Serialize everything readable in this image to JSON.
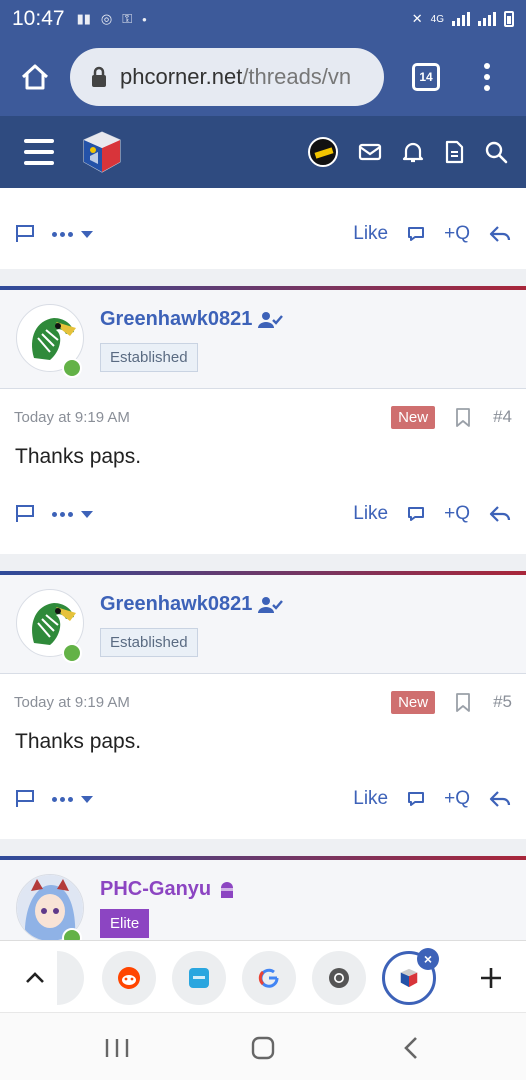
{
  "status_bar": {
    "time": "10:47",
    "network": "4G"
  },
  "browser": {
    "url_host": "phcorner.net",
    "url_path": "/threads/vn",
    "tab_count": "14"
  },
  "top_post": {
    "like_label": "Like",
    "quote_label": "Q"
  },
  "posts": [
    {
      "username": "Greenhawk0821",
      "user_title": "Established",
      "date": "Today at 9:19 AM",
      "new_label": "New",
      "number": "#4",
      "body": "Thanks paps.",
      "like_label": "Like",
      "quote_label": "Q"
    },
    {
      "username": "Greenhawk0821",
      "user_title": "Established",
      "date": "Today at 9:19 AM",
      "new_label": "New",
      "number": "#5",
      "body": "Thanks paps.",
      "like_label": "Like",
      "quote_label": "Q"
    }
  ],
  "partial_post": {
    "username": "PHC-Ganyu",
    "user_title": "Elite"
  },
  "colors": {
    "status_bar": "#3d5a9a",
    "site_header": "#2f4b80",
    "link": "#3d62b8",
    "new_badge": "#cf6f6f",
    "elite": "#8c45c2",
    "online": "#63b247"
  },
  "icons": [
    "home-icon",
    "lock-icon",
    "tabs-icon",
    "more-vert-icon",
    "hamburger-icon",
    "mail-icon",
    "bell-icon",
    "document-icon",
    "search-icon",
    "flag-icon",
    "bookmark-icon",
    "comment-icon",
    "reply-icon",
    "verified-user-icon"
  ]
}
